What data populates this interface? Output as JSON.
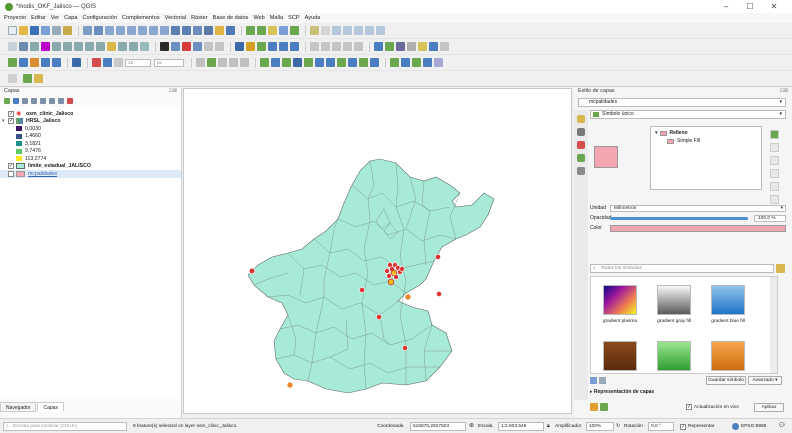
{
  "window": {
    "title": "*modis_OKF_Jalisco — QGIS",
    "controls": {
      "minimize": "–",
      "maximize": "☐",
      "close": "✕"
    }
  },
  "menu": [
    "Proyecto",
    "Editar",
    "Ver",
    "Capa",
    "Configuración",
    "Complementos",
    "Vectorial",
    "Ráster",
    "Base de datos",
    "Web",
    "Malla",
    "SCP",
    "Ayuda"
  ],
  "toolbar3": {
    "field1": "12",
    "field2": "px"
  },
  "layers_panel": {
    "title": "Capas",
    "close": "⊡⊠",
    "items": [
      {
        "label": "osm_clinic_Jalisco",
        "checked": "✓",
        "arrow": ""
      },
      {
        "label": "HRSL_Jalisco",
        "checked": "✓",
        "arrow": "▾"
      },
      {
        "label": "0,0030"
      },
      {
        "label": "1,4660"
      },
      {
        "label": "3,1821"
      },
      {
        "label": "9,7476"
      },
      {
        "label": "113,2774"
      },
      {
        "label": "limite_estadual_JALISCO",
        "checked": "✓"
      },
      {
        "label": "mcpalidades",
        "checked": ""
      }
    ],
    "ramp_colors": [
      "#3d1466",
      "#3b528b",
      "#21918c",
      "#5ec962",
      "#fde725"
    ],
    "tabs": [
      "Navegador",
      "Capas"
    ]
  },
  "map": {
    "state_fill": "#a8ead8",
    "state_stroke": "#5b6a63"
  },
  "style_panel": {
    "title": "Estilo de capas",
    "close": "⊡⊠",
    "layer_combo": "mcpalidades",
    "renderer": "Símbolo único",
    "tree_root": "Relleno",
    "tree_child": "Simple Fill",
    "unit_label": "Unidad",
    "unit_value": "Milímetros",
    "opacity_label": "Opacidad",
    "opacity_value": "100,0 %",
    "opacity_fraction": 1.0,
    "color_label": "Color",
    "fill_color": "#f4a6b0",
    "search_placeholder": "Todos los símbolos",
    "gallery": [
      "gradient plasma",
      "gradient gray fill",
      "gradient blue fill"
    ],
    "save_symbol": "Guardar símbolo",
    "advanced": "Avanzado ▾",
    "layer_render": "Representación de capas",
    "live_update": "Actualización en vivo",
    "apply": "Aplicar"
  },
  "status": {
    "search_placeholder": "Escriba para localizar (Ctrl+K)",
    "message": "9 feature(s) selected on layer osm_clinic_Jalisco.",
    "coord_label": "Coordenada",
    "coord_value": "615876,2927503",
    "scale_label": "Escala",
    "scale_value": "1:2.603.548",
    "magnifier_label": "Amplificador",
    "magnifier_value": "100%",
    "rotation_label": "Rotación",
    "rotation_value": "0,0 °",
    "render_label": "Representar",
    "crs": "EPSG:9988"
  }
}
